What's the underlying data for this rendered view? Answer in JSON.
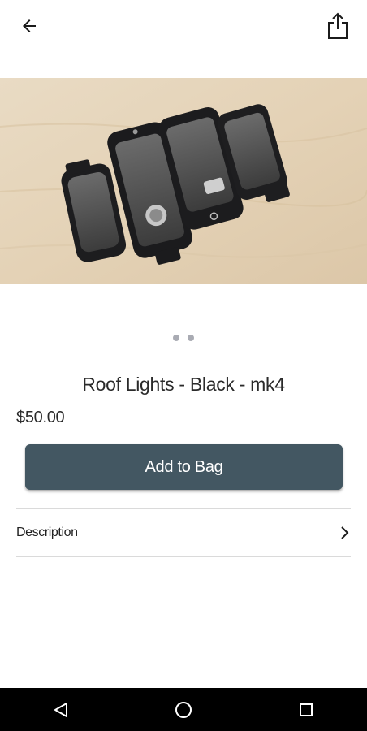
{
  "header": {
    "back_icon": "arrow-left-icon",
    "share_icon": "share-icon"
  },
  "product": {
    "image_alt": "Four black roof light units on a wooden surface",
    "title": "Roof Lights - Black - mk4",
    "price": "$50.00",
    "image_count": 2,
    "active_image": 1
  },
  "actions": {
    "add_to_bag_label": "Add to Bag"
  },
  "sections": {
    "description_label": "Description"
  },
  "system_nav": {
    "back": "nav-back-icon",
    "home": "nav-home-icon",
    "recents": "nav-recents-icon"
  },
  "colors": {
    "button_bg": "#435762",
    "button_text": "#ffffff",
    "dot_color": "#a9abb3",
    "nav_bar": "#000000"
  }
}
